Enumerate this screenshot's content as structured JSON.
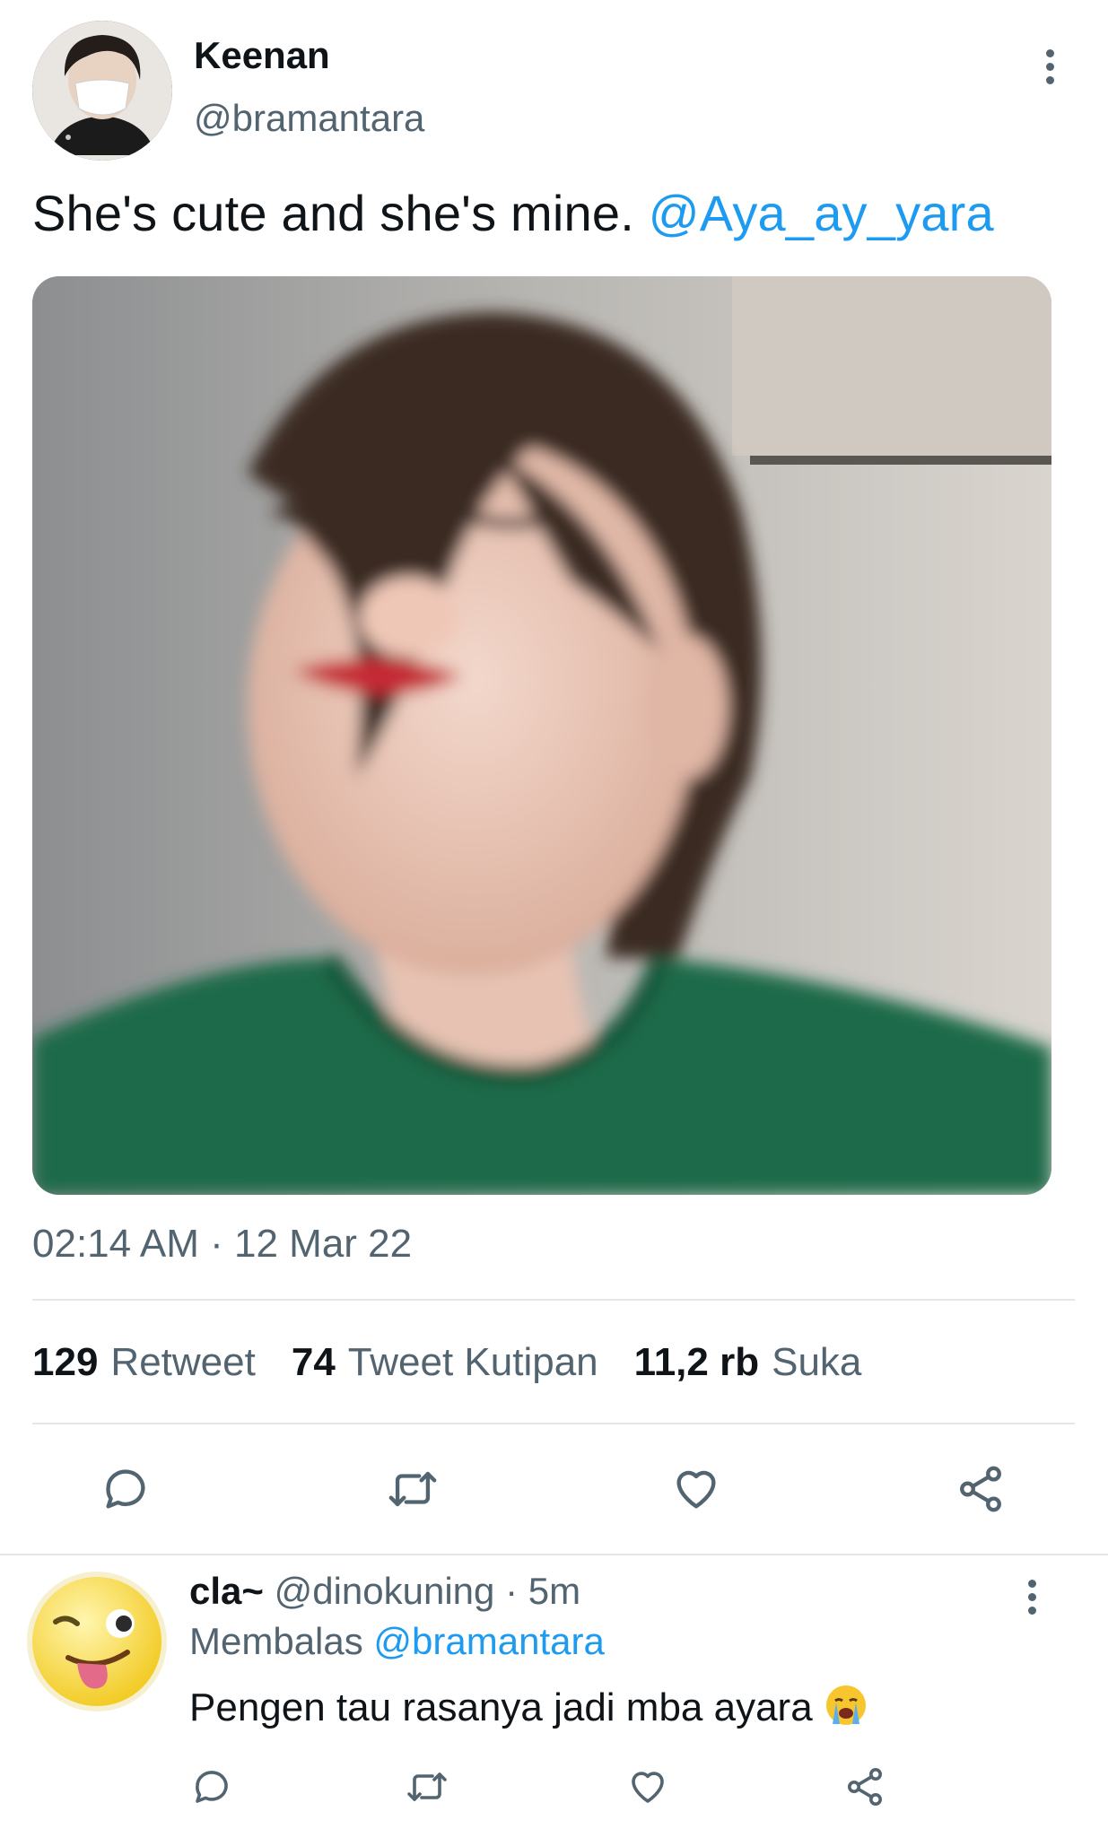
{
  "tweet": {
    "display_name": "Keenan",
    "handle": "@bramantara",
    "text": "She's cute and she's mine.",
    "mention": "@Aya_ay_yara",
    "timestamp": "02:14 AM · 12 Mar 22",
    "stats": {
      "retweets_count": "129",
      "retweets_label": "Retweet",
      "quotes_count": "74",
      "quotes_label": "Tweet Kutipan",
      "likes_count": "11,2 rb",
      "likes_label": "Suka"
    },
    "actions": [
      "reply-icon",
      "retweet-icon",
      "like-icon",
      "share-icon"
    ]
  },
  "reply": {
    "display_name": "cla~",
    "handle": "@dinokuning",
    "time": "· 5m",
    "replying_prefix": "Membalas",
    "replying_to": "@bramantara",
    "text": "Pengen tau rasanya jadi mba ayara",
    "emoji": "loudly-crying-face-emoji",
    "actions": [
      "reply-icon",
      "retweet-icon",
      "like-icon",
      "share-icon"
    ]
  },
  "colors": {
    "accent": "#1d9bf0",
    "text_primary": "#0f1419",
    "text_secondary": "#536471",
    "divider": "#e3e7ea",
    "sweater_green": "#1f6b4a"
  }
}
